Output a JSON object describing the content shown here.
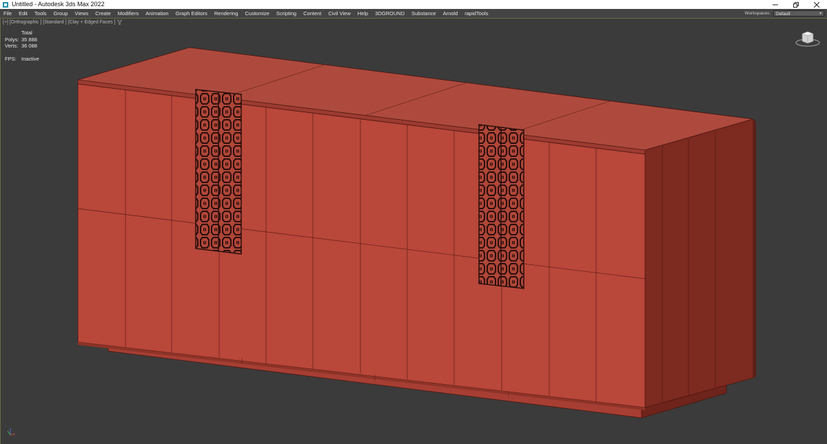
{
  "window": {
    "title": "Untitled - Autodesk 3ds Max 2022"
  },
  "menu": [
    "File",
    "Edit",
    "Tools",
    "Group",
    "Views",
    "Create",
    "Modifiers",
    "Animation",
    "Graph Editors",
    "Rendering",
    "Customize",
    "Scripting",
    "Content",
    "Civil View",
    "Help",
    "3DGROUND",
    "Substance",
    "Arnold",
    "rapidTools"
  ],
  "workspace": {
    "label": "Workspaces:",
    "value": "Default"
  },
  "viewport": {
    "labels": [
      "[+]",
      "[Orthographic ]",
      "[Standard ]",
      "[Clay + Edged Faces ]"
    ]
  },
  "stats": {
    "header": "Total",
    "polys_label": "Polys:",
    "polys_value": "35 888",
    "verts_label": "Verts:",
    "verts_value": "36 088",
    "fps_label": "FPS:",
    "fps_value": "Inactive"
  },
  "colors": {
    "clay_front": "#b9473a",
    "clay_top": "#ad4a3d",
    "clay_side": "#7d2a20",
    "viewport_bg": "#3b3b3b",
    "menubar_bg": "#444444"
  },
  "icons": {
    "logo": "3ds-max-logo-icon",
    "viewcube": "viewcube-icon",
    "tripod": "axis-tripod-icon",
    "filter": "filter-icon"
  }
}
